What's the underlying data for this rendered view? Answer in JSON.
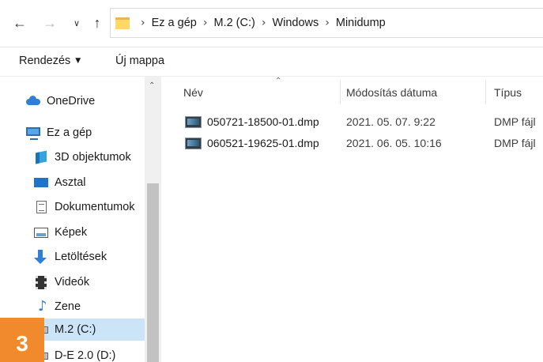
{
  "address_bar": {
    "back_icon": "arrow-left",
    "forward_icon": "arrow-right",
    "recent_icon": "chevron-down",
    "up_icon": "arrow-up",
    "folder_icon": "folder",
    "breadcrumbs": [
      "Ez a gép",
      "M.2 (C:)",
      "Windows",
      "Minidump"
    ]
  },
  "command_bar": {
    "sort_label": "Rendezés",
    "new_folder_label": "Új mappa"
  },
  "nav_pane": {
    "items": [
      {
        "label": "OneDrive",
        "icon": "onedrive-cloud"
      },
      {
        "label": "Ez a gép",
        "icon": "computer"
      },
      {
        "label": "3D objektumok",
        "icon": "3d-objects"
      },
      {
        "label": "Asztal",
        "icon": "desktop"
      },
      {
        "label": "Dokumentumok",
        "icon": "documents"
      },
      {
        "label": "Képek",
        "icon": "pictures"
      },
      {
        "label": "Letöltések",
        "icon": "downloads"
      },
      {
        "label": "Videók",
        "icon": "videos"
      },
      {
        "label": "Zene",
        "icon": "music"
      },
      {
        "label": "M.2 (C:)",
        "icon": "drive",
        "selected": true
      },
      {
        "label": "D-E 2.0 (D:)",
        "icon": "drive"
      }
    ]
  },
  "file_list": {
    "columns": [
      "Név",
      "Módosítás dátuma",
      "Típus"
    ],
    "rows": [
      {
        "name": "050721-18500-01.dmp",
        "modified": "2021. 05. 07. 9:22",
        "type": "DMP fájl"
      },
      {
        "name": "060521-19625-01.dmp",
        "modified": "2021. 06. 05. 10:16",
        "type": "DMP fájl"
      }
    ]
  },
  "step_badge": "3",
  "colors": {
    "selection": "#cce4f7",
    "badge": "#f1892d",
    "accent": "#2f7ed8"
  }
}
